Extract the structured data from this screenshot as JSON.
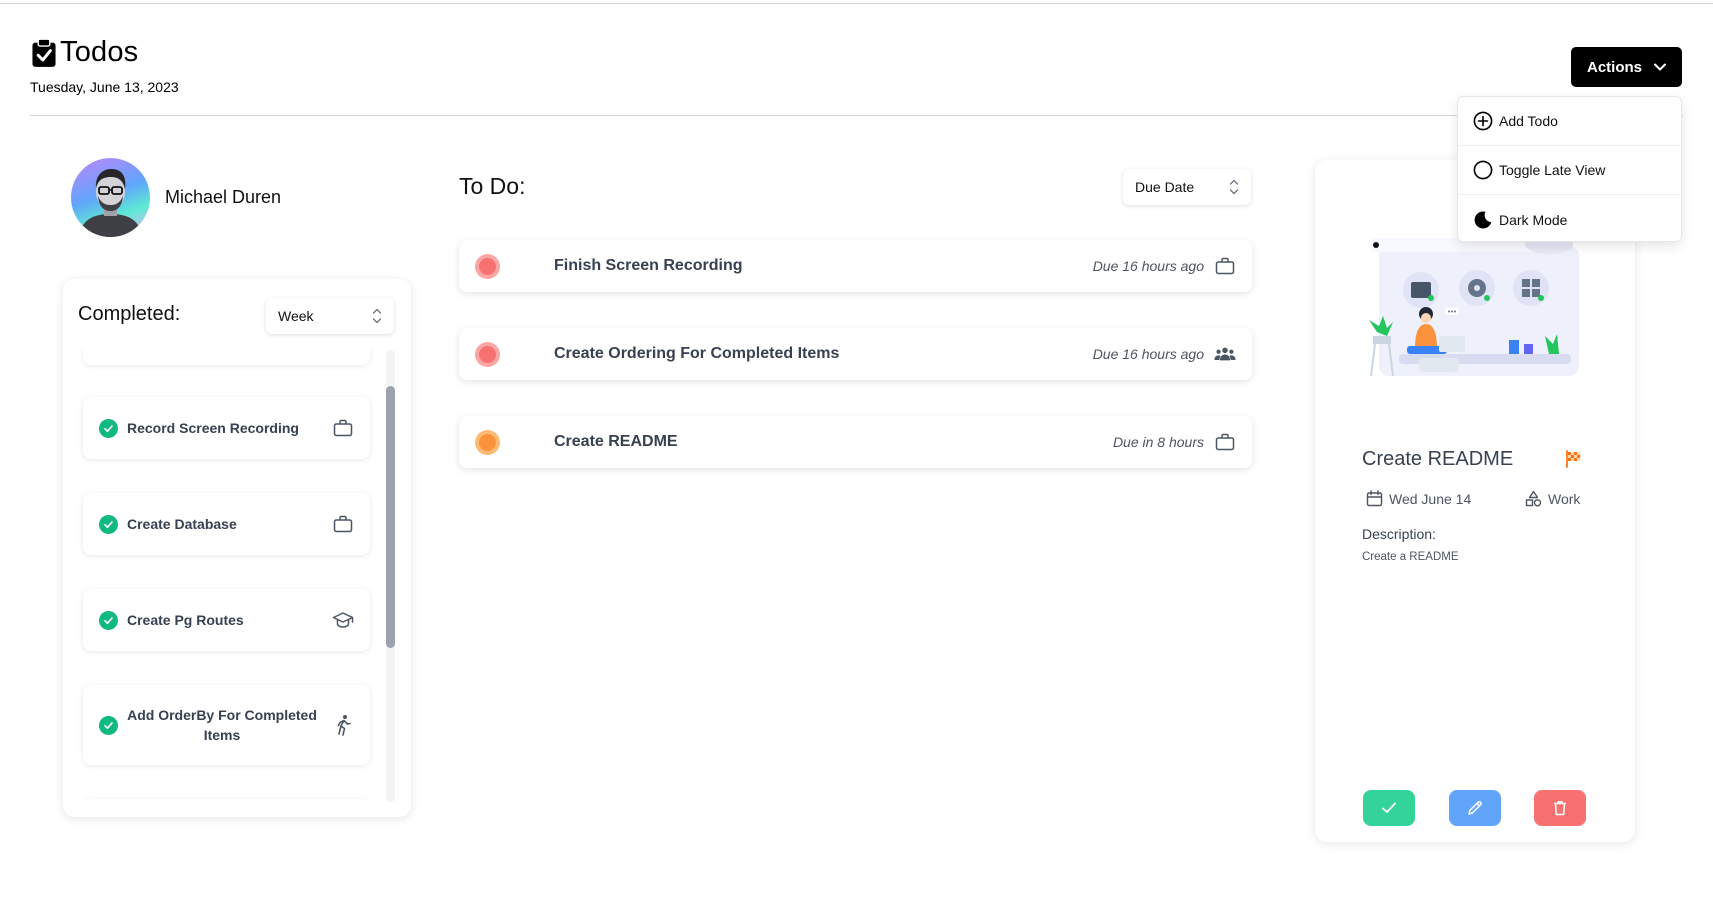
{
  "header": {
    "title": "Todos",
    "date": "Tuesday, June 13, 2023",
    "actions_label": "Actions"
  },
  "actions_menu": [
    {
      "label": "Add Todo",
      "icon": "plus-circle-icon"
    },
    {
      "label": "Toggle Late View",
      "icon": "circle-icon"
    },
    {
      "label": "Dark Mode",
      "icon": "moon-icon"
    }
  ],
  "profile": {
    "name": "Michael Duren"
  },
  "completed": {
    "title": "Completed:",
    "period": "Week",
    "items": [
      {
        "label": "Record Screen Recording",
        "icon": "briefcase-icon"
      },
      {
        "label": "Create Database",
        "icon": "briefcase-icon"
      },
      {
        "label": "Create Pg Routes",
        "icon": "graduation-cap-icon"
      },
      {
        "label": "Add OrderBy For Completed Items",
        "icon": "running-person-icon"
      }
    ]
  },
  "todo": {
    "title": "To Do:",
    "sort": "Due Date",
    "items": [
      {
        "label": "Finish Screen Recording",
        "due": "Due 16 hours ago",
        "icon": "briefcase-icon",
        "status_color": "#f87171"
      },
      {
        "label": "Create Ordering For Completed Items",
        "due": "Due 16 hours ago",
        "icon": "people-icon",
        "status_color": "#f87171"
      },
      {
        "label": "Create README",
        "due": "Due in 8 hours",
        "icon": "briefcase-icon",
        "status_color": "#fb923c"
      }
    ]
  },
  "detail": {
    "title": "Create README",
    "date": "Wed June 14",
    "category": "Work",
    "description_label": "Description:",
    "description": "Create a README",
    "flag_color": "#f97316",
    "complete_color": "#34d399",
    "edit_color": "#60a5fa",
    "delete_color": "#f87171"
  }
}
